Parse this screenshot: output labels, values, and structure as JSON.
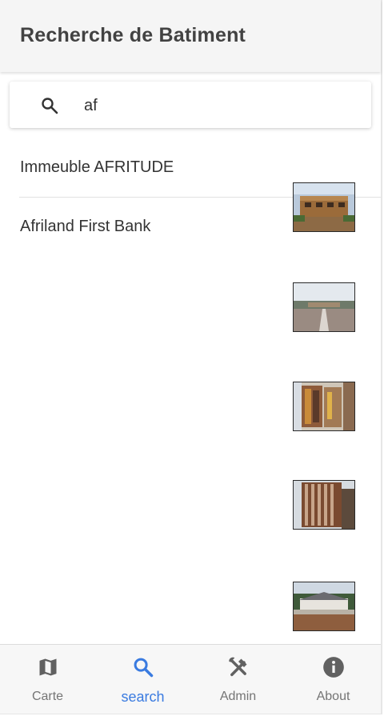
{
  "app": {
    "title": "Recherche de Batiment"
  },
  "search": {
    "value": "af",
    "icon": "search-icon"
  },
  "results": [
    {
      "label": "Immeuble AFRITUDE"
    },
    {
      "label": "Afriland First Bank"
    }
  ],
  "bottom_nav": {
    "active": "search",
    "accent": "#3a7be0",
    "items": [
      {
        "label": "Carte",
        "icon": "map-icon"
      },
      {
        "label": "search",
        "icon": "search-icon"
      },
      {
        "label": "Admin",
        "icon": "tools-icon"
      },
      {
        "label": "About",
        "icon": "info-icon"
      }
    ]
  }
}
